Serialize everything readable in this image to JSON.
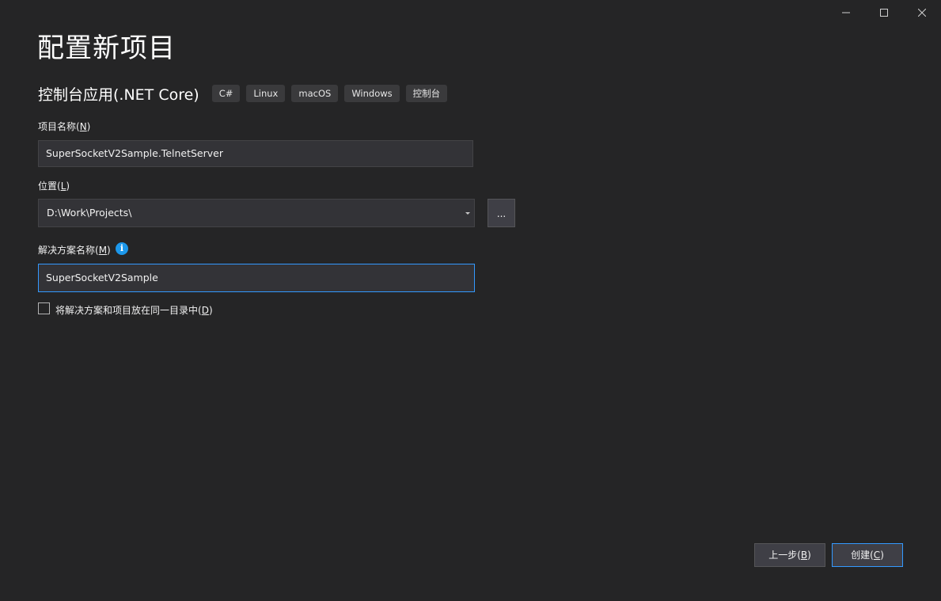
{
  "window": {
    "controls": {
      "minimize_icon": "minimize-icon",
      "maximize_icon": "maximize-icon",
      "close_icon": "close-icon"
    }
  },
  "page": {
    "title": "配置新项目"
  },
  "template": {
    "name": "控制台应用(.NET Core)",
    "tags": [
      "C#",
      "Linux",
      "macOS",
      "Windows",
      "控制台"
    ]
  },
  "project_name": {
    "label": "项目名称(",
    "accesskey": "N",
    "label_end": ")",
    "value": "SuperSocketV2Sample.TelnetServer"
  },
  "location": {
    "label": "位置(",
    "accesskey": "L",
    "label_end": ")",
    "value": "D:\\Work\\Projects\\",
    "browse_label": "..."
  },
  "solution_name": {
    "label": "解决方案名称(",
    "accesskey": "M",
    "label_end": ")",
    "info_glyph": "i",
    "value": "SuperSocketV2Sample"
  },
  "same_directory": {
    "label": "将解决方案和项目放在同一目录中(",
    "accesskey": "D",
    "label_end": ")",
    "checked": false
  },
  "footer": {
    "back": {
      "label": "上一步(",
      "accesskey": "B",
      "label_end": ")"
    },
    "create": {
      "label": "创建(",
      "accesskey": "C",
      "label_end": ")"
    }
  },
  "colors": {
    "background": "#252526",
    "input_background": "#333337",
    "focus_border": "#3399ff",
    "info_blue": "#1c97ea"
  }
}
